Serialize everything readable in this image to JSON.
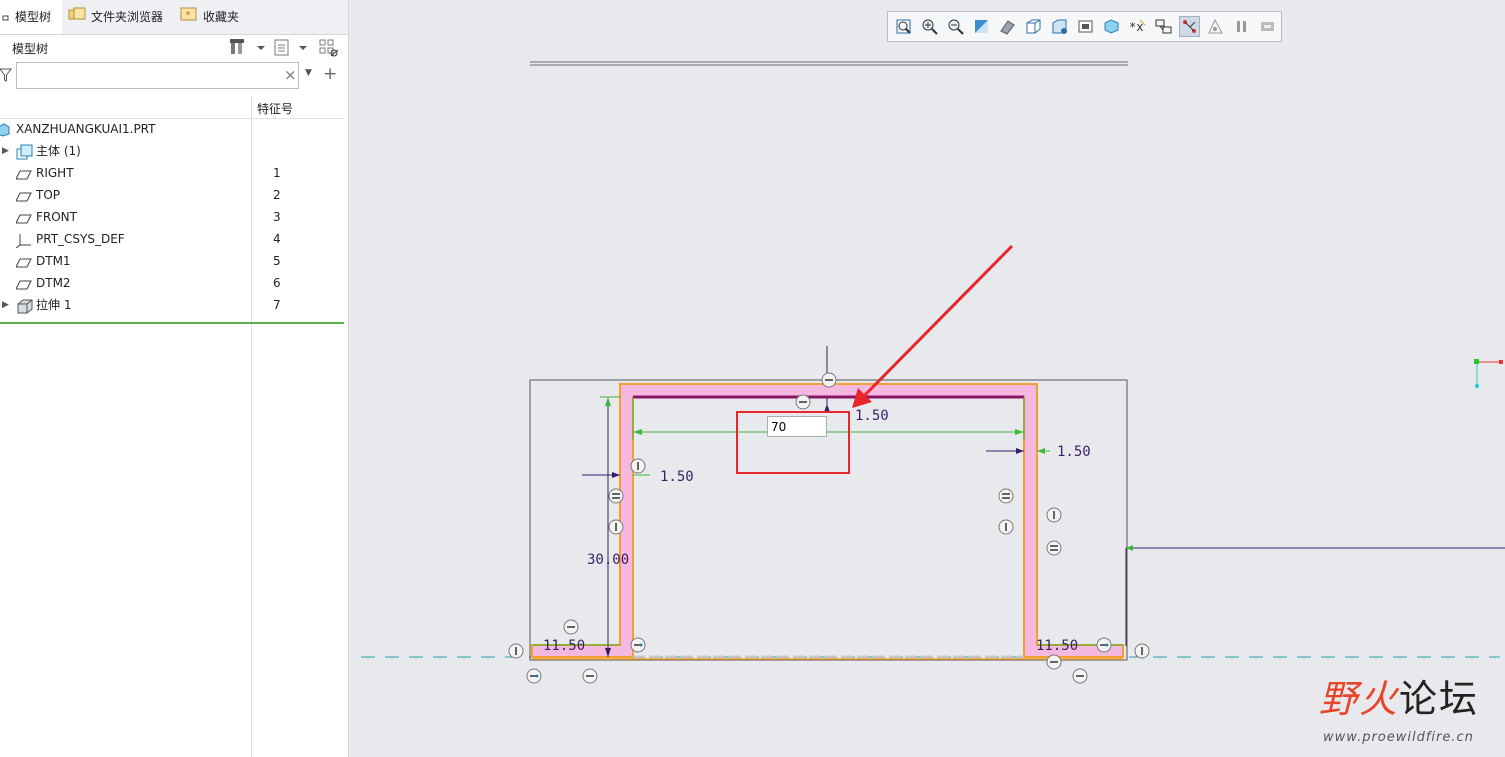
{
  "tabs": [
    {
      "label": "模型树",
      "icon": "model-tree-icon"
    },
    {
      "label": "文件夹浏览器",
      "icon": "folder-browser-icon"
    },
    {
      "label": "收藏夹",
      "icon": "favorites-icon"
    }
  ],
  "tree": {
    "title": "模型树",
    "search": {
      "value": "",
      "placeholder": ""
    },
    "column_header": "特征号",
    "items": [
      {
        "label": "XANZHUANGKUAI1.PRT",
        "number": "",
        "icon": "part-icon"
      },
      {
        "label": "主体 (1)",
        "number": "",
        "icon": "body-icon",
        "expandable": true
      },
      {
        "label": "RIGHT",
        "number": "1",
        "icon": "datum-plane-icon"
      },
      {
        "label": "TOP",
        "number": "2",
        "icon": "datum-plane-icon"
      },
      {
        "label": "FRONT",
        "number": "3",
        "icon": "datum-plane-icon"
      },
      {
        "label": "PRT_CSYS_DEF",
        "number": "4",
        "icon": "coordinate-system-icon"
      },
      {
        "label": "DTM1",
        "number": "5",
        "icon": "datum-plane-icon"
      },
      {
        "label": "DTM2",
        "number": "6",
        "icon": "datum-plane-icon"
      },
      {
        "label": "拉伸 1",
        "number": "7",
        "icon": "extrude-icon",
        "expandable": true
      }
    ]
  },
  "graphics_toolbar": [
    "refit-icon",
    "zoom-in-icon",
    "zoom-out-icon",
    "repaint-icon",
    "display-style-icon",
    "saved-views-icon",
    "view-manager-icon",
    "perspective-icon",
    "section-icon",
    "datum-display-icon",
    "annotation-display-icon",
    "sketch-display-icon",
    "spin-center-icon",
    "pause-icon",
    "sketch-view-icon"
  ],
  "sketch": {
    "dimension_input": "70",
    "dimensions": {
      "top_thickness": "1.50",
      "left_wall": "1.50",
      "right_wall": "1.50",
      "height": "30.00",
      "left_flange": "11.50",
      "right_flange": "11.50"
    }
  },
  "watermark": {
    "title_colored": "野火",
    "title_plain": "论坛",
    "url": "www.proewildfire.cn"
  },
  "colors": {
    "sketch_fill": "#f5b8df",
    "outline": "#f0a030",
    "dimension": "#3cb83c",
    "highlight_box": "#e8252a"
  }
}
